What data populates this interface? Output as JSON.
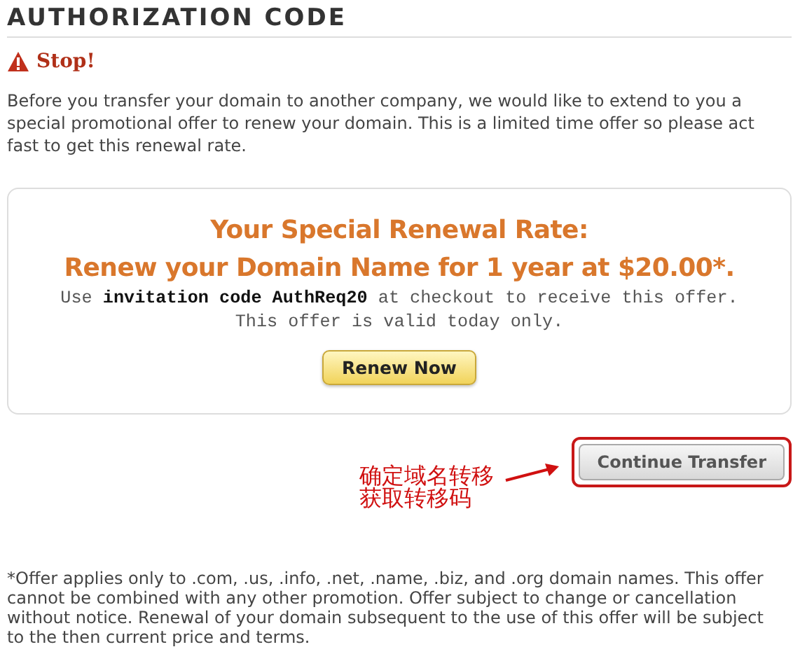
{
  "section_title": "AUTHORIZATION CODE",
  "alert": {
    "kind": "warning",
    "title": "Stop!"
  },
  "intro": "Before you transfer your domain to another company, we would like to extend to you a special promotional offer to renew your domain. This is a limited time offer so please act fast to get this renewal rate.",
  "offer": {
    "headline": [
      "Your Special Renewal Rate:",
      "Renew your Domain Name for 1 year at $20.00*."
    ],
    "details": [
      "Use **invitation code AuthReq20** at checkout to receive this offer.",
      "This offer is valid today only."
    ],
    "button": "Renew Now"
  },
  "continue_button": {
    "label": "Continue Transfer",
    "highlighted": true
  },
  "annotation": {
    "lines": [
      "确定域名转移",
      "获取转移码"
    ]
  },
  "footnote": "*Offer applies only to .com, .us, .info, .net, .name, .biz, and .org domain names. This offer cannot be combined with any other promotion. Offer subject to change or cancellation without notice. Renewal of your domain subsequent to the use of this offer will be subject to the then current price and terms."
}
